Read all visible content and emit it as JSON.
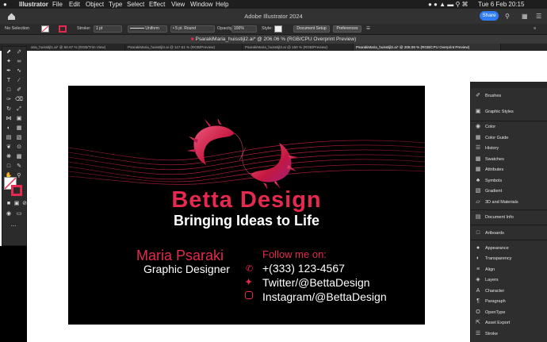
{
  "menubar": {
    "app_name": "Illustrator",
    "menus": [
      "File",
      "Edit",
      "Object",
      "Type",
      "Select",
      "Effect",
      "View",
      "Window",
      "Help"
    ],
    "datetime": "Tue 6 Feb  20:15"
  },
  "appbar": {
    "title": "Adobe Illustrator 2024",
    "share_label": "Share"
  },
  "control_bar": {
    "selection_state": "No Selection",
    "stroke_label": "Stroke:",
    "stroke_value": "1 pt",
    "profile_label": "Uniform",
    "brush_value": "5 pt. Round",
    "opacity_label": "Opacity:",
    "opacity_value": "100%",
    "style_label": "Style:",
    "document_setup": "Document Setup",
    "preferences": "Preferences"
  },
  "document": {
    "title": "PsarakiMaria_huisstijl2.ai* @ 206.06 % (RGB/CPU Overprint Preview)"
  },
  "tabs": [
    {
      "label": "aria_huisstijl1.ai* @ 66.67 % (RGB/Trim View)"
    },
    {
      "label": "PsarakiMaria_huisstijl4.ai @ 117.61 % (RGB/Preview)"
    },
    {
      "label": "PsarakiMaria_huisstijl3.ai @ 150 % (RGB/Preview)"
    },
    {
      "label": "PsarakiMaria_huisstijl2.ai* @ 206.06 % (RGB/CPU Overprint Preview)"
    }
  ],
  "business_card": {
    "brand": "Betta Design",
    "tagline": "Bringing Ideas to Life",
    "name": "Maria Psaraki",
    "role": "Graphic Designer",
    "follow_label": "Follow me on:",
    "contacts": [
      {
        "icon": "phone-icon",
        "text": "+(333) 123-4567"
      },
      {
        "icon": "twitter-icon",
        "text": "Twitter/@BettaDesign"
      },
      {
        "icon": "instagram-icon",
        "text": "Instagram/@BettaDesign"
      }
    ]
  },
  "panels": [
    {
      "label": "Brushes",
      "icon": "brushes-icon"
    },
    {
      "label": "Graphic Styles",
      "icon": "graphic-styles-icon"
    },
    {
      "label": "Color",
      "icon": "color-icon"
    },
    {
      "label": "Color Guide",
      "icon": "color-guide-icon"
    },
    {
      "label": "History",
      "icon": "history-icon"
    },
    {
      "label": "Swatches",
      "icon": "swatches-icon"
    },
    {
      "label": "Attributes",
      "icon": "attributes-icon"
    },
    {
      "label": "Symbols",
      "icon": "symbols-icon"
    },
    {
      "label": "Gradient",
      "icon": "gradient-icon"
    },
    {
      "label": "3D and Materials",
      "icon": "3d-materials-icon"
    },
    {
      "label": "Document Info",
      "icon": "document-info-icon"
    },
    {
      "label": "Artboards",
      "icon": "artboards-icon"
    },
    {
      "label": "Appearance",
      "icon": "appearance-icon"
    },
    {
      "label": "Transparency",
      "icon": "transparency-icon"
    },
    {
      "label": "Align",
      "icon": "align-icon"
    },
    {
      "label": "Layers",
      "icon": "layers-icon"
    },
    {
      "label": "Character",
      "icon": "character-icon"
    },
    {
      "label": "Paragraph",
      "icon": "paragraph-icon"
    },
    {
      "label": "OpenType",
      "icon": "opentype-icon"
    },
    {
      "label": "Asset Export",
      "icon": "asset-export-icon"
    },
    {
      "label": "Stroke",
      "icon": "stroke-icon"
    }
  ],
  "colors": {
    "brand_red": "#e5294f",
    "share_blue": "#2e7df6"
  }
}
